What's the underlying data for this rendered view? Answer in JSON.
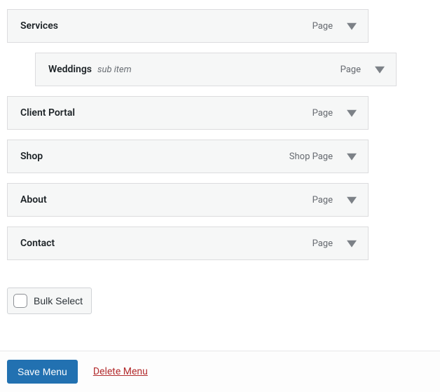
{
  "menu_items": [
    {
      "title": "Services",
      "type": "Page",
      "sub": false,
      "indented": false
    },
    {
      "title": "Weddings",
      "type": "Page",
      "sub": true,
      "indented": true
    },
    {
      "title": "Client Portal",
      "type": "Page",
      "sub": false,
      "indented": false
    },
    {
      "title": "Shop",
      "type": "Shop Page",
      "sub": false,
      "indented": false
    },
    {
      "title": "About",
      "type": "Page",
      "sub": false,
      "indented": false
    },
    {
      "title": "Contact",
      "type": "Page",
      "sub": false,
      "indented": false
    }
  ],
  "sub_item_label": "sub item",
  "bulk_select_label": "Bulk Select",
  "save_menu_label": "Save Menu",
  "delete_menu_label": "Delete Menu"
}
